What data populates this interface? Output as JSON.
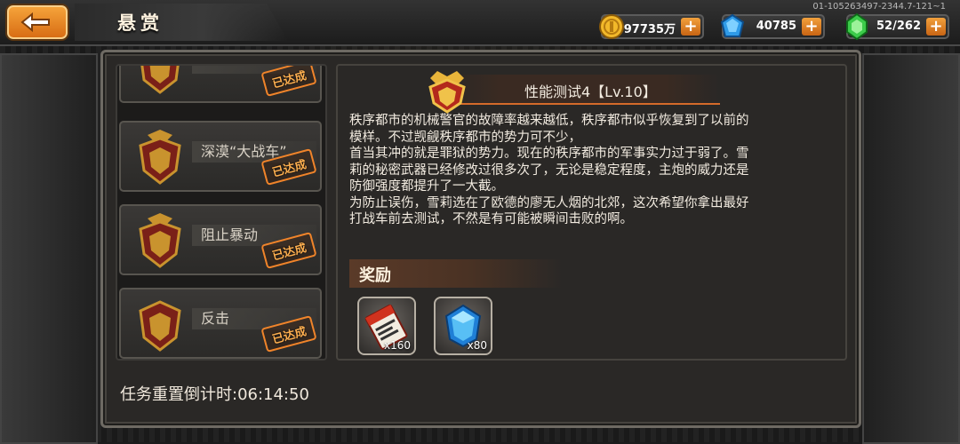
{
  "header": {
    "title": "悬赏",
    "build_info": "01-105263497-2344.7-121~1"
  },
  "resources": {
    "gold": "97735万",
    "gems": "40785",
    "energy": "52/262"
  },
  "missions": [
    {
      "name": "",
      "status": "已达成"
    },
    {
      "name": "深漠“大战车”",
      "status": "已达成"
    },
    {
      "name": "阻止暴动",
      "status": "已达成"
    },
    {
      "name": "反击",
      "status": "已达成"
    }
  ],
  "detail": {
    "title": "性能测试4【Lv.10】",
    "description": [
      "秩序都市的机械警官的故障率越来越低，秩序都市似乎恢复到了以前的",
      "模样。不过觊觎秩序都市的势力可不少，",
      "首当其冲的就是罪狱的势力。现在的秩序都市的军事实力过于弱了。雪",
      "莉的秘密武器已经修改过很多次了，无论是稳定程度，主炮的威力还是",
      "防御强度都提升了一大截。",
      "为防止误伤，雪莉选在了欧德的廖无人烟的北郊，这次希望你拿出最好",
      "打战车前去测试，不然是有可能被瞬间击败的啊。"
    ]
  },
  "rewards": {
    "label": "奖励",
    "items": [
      {
        "icon": "ticket-icon",
        "qty": "x160"
      },
      {
        "icon": "blue-crystal-icon",
        "qty": "x80"
      }
    ]
  },
  "timer_text": "任务重置倒计时:06:14:50"
}
